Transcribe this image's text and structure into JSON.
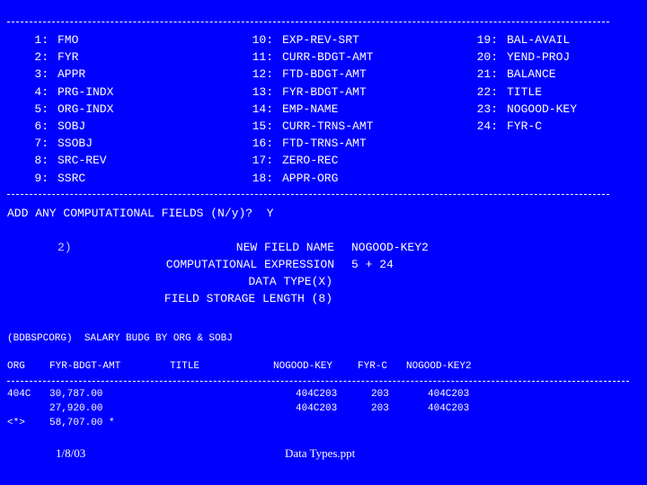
{
  "field_list": {
    "columns": [
      [
        {
          "num": "1:",
          "name": "FMO"
        },
        {
          "num": "2:",
          "name": "FYR"
        },
        {
          "num": "3:",
          "name": "APPR"
        },
        {
          "num": "4:",
          "name": "PRG-INDX"
        },
        {
          "num": "5:",
          "name": "ORG-INDX"
        },
        {
          "num": "6:",
          "name": "SOBJ"
        },
        {
          "num": "7:",
          "name": "SSOBJ"
        },
        {
          "num": "8:",
          "name": "SRC-REV"
        },
        {
          "num": "9:",
          "name": "SSRC"
        }
      ],
      [
        {
          "num": "10:",
          "name": "EXP-REV-SRT"
        },
        {
          "num": "11:",
          "name": "CURR-BDGT-AMT"
        },
        {
          "num": "12:",
          "name": "FTD-BDGT-AMT"
        },
        {
          "num": "13:",
          "name": "FYR-BDGT-AMT"
        },
        {
          "num": "14:",
          "name": "EMP-NAME"
        },
        {
          "num": "15:",
          "name": "CURR-TRNS-AMT"
        },
        {
          "num": "16:",
          "name": "FTD-TRNS-AMT"
        },
        {
          "num": "17:",
          "name": "ZERO-REC"
        },
        {
          "num": "18:",
          "name": "APPR-ORG"
        }
      ],
      [
        {
          "num": "19:",
          "name": "BAL-AVAIL"
        },
        {
          "num": "20:",
          "name": "YEND-PROJ"
        },
        {
          "num": "21:",
          "name": "BALANCE"
        },
        {
          "num": "22:",
          "name": "TITLE"
        },
        {
          "num": "23:",
          "name": "NOGOOD-KEY"
        },
        {
          "num": "24:",
          "name": "FYR-C"
        }
      ]
    ]
  },
  "prompt": {
    "question": "ADD ANY COMPUTATIONAL FIELDS (N/y)?",
    "answer": "Y"
  },
  "computed_field": {
    "index": "2)",
    "name_label": "NEW FIELD NAME",
    "name_value": "NOGOOD-KEY2",
    "expr_label": "COMPUTATIONAL EXPRESSION",
    "expr_value": "5 + 24",
    "type_label": "DATA TYPE(X)",
    "length_label": "FIELD STORAGE LENGTH (8)"
  },
  "report": {
    "title": "(BDBSPCORG)  SALARY BUDG BY ORG & SOBJ",
    "headers": [
      "ORG",
      "FYR-BDGT-AMT",
      "TITLE",
      "NOGOOD-KEY",
      "FYR-C",
      "NOGOOD-KEY2"
    ],
    "rows": [
      {
        "org": "404C",
        "amt": "30,787.00",
        "title": "",
        "key": "404C203",
        "fyrc": "203",
        "key2": "404C203"
      },
      {
        "org": "",
        "amt": "27,920.00",
        "title": "",
        "key": "404C203",
        "fyrc": "203",
        "key2": "404C203"
      }
    ],
    "total": {
      "org": "<*>",
      "amt": "58,707.00 *"
    }
  },
  "footer": {
    "date": "1/8/03",
    "filename": "Data Types.ppt"
  }
}
